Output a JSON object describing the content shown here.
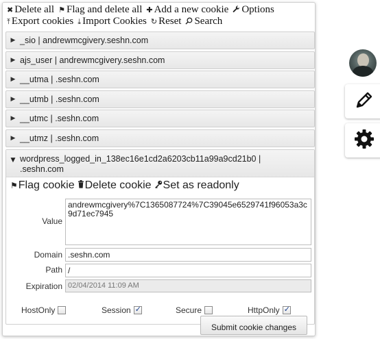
{
  "toolbar": {
    "row1": [
      {
        "icon": "close-icon",
        "glyph": "✖",
        "label": "Delete all"
      },
      {
        "icon": "flag-icon",
        "glyph": "⚑",
        "label": "Flag and delete all"
      },
      {
        "icon": "plus-icon",
        "glyph": "✚",
        "label": "Add a new cookie"
      },
      {
        "icon": "wrench-icon",
        "glyph": "🔧",
        "label": "Options"
      }
    ],
    "row2": [
      {
        "icon": "export-icon",
        "glyph": "⤒",
        "label": "Export cookies"
      },
      {
        "icon": "import-icon",
        "glyph": "⤓",
        "label": "Import Cookies"
      },
      {
        "icon": "reset-icon",
        "glyph": "↻",
        "label": "Reset"
      },
      {
        "icon": "search-icon",
        "glyph": "⌕",
        "label": "Search"
      }
    ]
  },
  "cookies": [
    {
      "name": "_sio",
      "domain": "andrewmcgivery.seshn.com"
    },
    {
      "name": "ajs_user",
      "domain": "andrewmcgivery.seshn.com"
    },
    {
      "name": "__utma",
      "domain": ".seshn.com"
    },
    {
      "name": "__utmb",
      "domain": ".seshn.com"
    },
    {
      "name": "__utmc",
      "domain": ".seshn.com"
    },
    {
      "name": "__utmz",
      "domain": ".seshn.com"
    }
  ],
  "expanded": {
    "header_line1": "wordpress_logged_in_138ec16e1cd2a6203cb11a99a9cd21b0 |",
    "header_line2": ".seshn.com",
    "actions": {
      "flag_label": "Flag cookie",
      "delete_label": "Delete cookie",
      "readonly_label": "Set as readonly"
    },
    "labels": {
      "value": "Value",
      "domain": "Domain",
      "path": "Path",
      "expiration": "Expiration"
    },
    "fields": {
      "value": "andrewmcgivery%7C1365087724%7C39045e6529741f96053a3c9d71ec7945",
      "domain": ".seshn.com",
      "path": "/",
      "expiration": "02/04/2014 11:09 AM"
    },
    "checkboxes": {
      "hostonly": {
        "label": "HostOnly",
        "checked": false
      },
      "session": {
        "label": "Session",
        "checked": true
      },
      "secure": {
        "label": "Secure",
        "checked": false
      },
      "httponly": {
        "label": "HttpOnly",
        "checked": true
      }
    },
    "submit_label": "Submit cookie changes"
  },
  "side_panel": {
    "icons": [
      "avatar",
      "pencil-icon",
      "gear-icon"
    ]
  }
}
